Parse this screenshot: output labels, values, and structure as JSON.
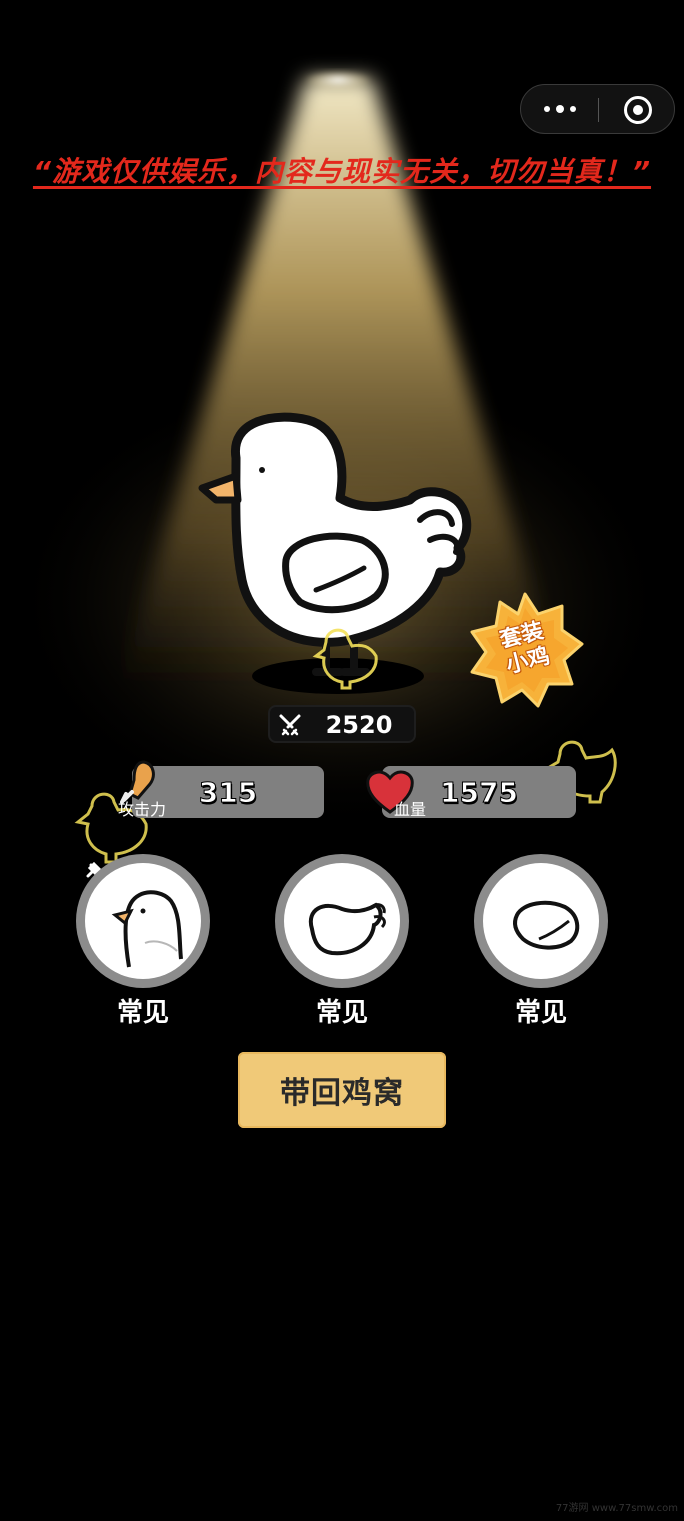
{
  "capsule": {
    "more_icon": "more-dots-icon",
    "close_icon": "target-close-icon"
  },
  "disclaimer": "“游戏仅供娱乐，内容与现实无关，切勿当真！”",
  "badge": {
    "line1": "套装",
    "line2": "小鸡"
  },
  "power": {
    "icon": "crossed-swords-icon",
    "value": "2520"
  },
  "stats": {
    "attack": {
      "label": "攻击力",
      "value": "315",
      "icon": "drumstick-icon"
    },
    "hp": {
      "label": "血量",
      "value": "1575",
      "icon": "heart-icon"
    }
  },
  "parts": [
    {
      "label": "常见",
      "icon": "chicken-head-icon"
    },
    {
      "label": "常见",
      "icon": "chicken-body-icon"
    },
    {
      "label": "常见",
      "icon": "chicken-wing-icon"
    }
  ],
  "action_button": "带回鸡窝",
  "watermark": "77游网  www.77smw.com",
  "colors": {
    "disclaimer": "#e3281c",
    "button": "#f0c978",
    "badge": "#f6b23a",
    "stat_bar": "#808080"
  }
}
